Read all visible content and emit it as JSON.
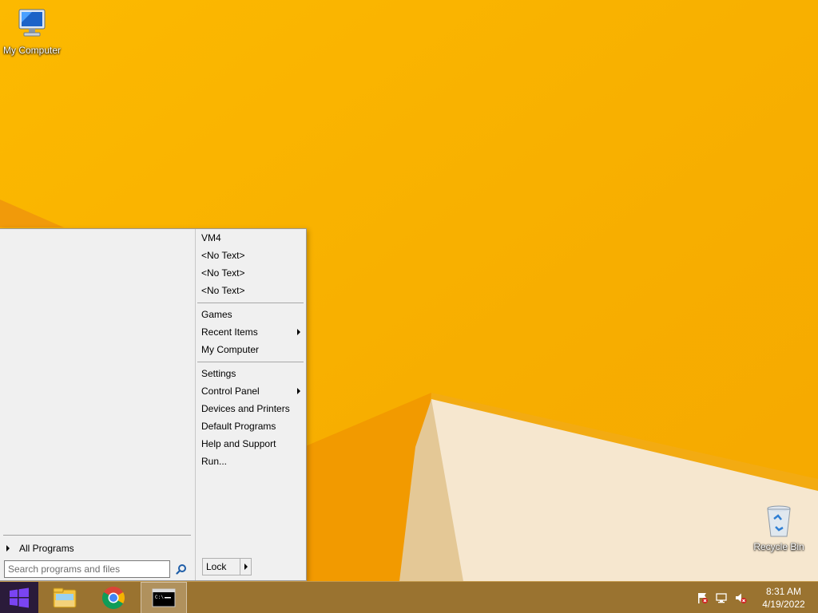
{
  "desktop": {
    "icons": [
      {
        "label": "My Computer"
      },
      {
        "label": "Recycle Bin"
      }
    ]
  },
  "start_menu": {
    "left": {
      "all_programs_label": "All Programs",
      "search_placeholder": "Search programs and files"
    },
    "right": {
      "group1": [
        "VM4",
        "<No Text>",
        "<No Text>",
        "<No Text>"
      ],
      "group2": [
        {
          "label": "Games",
          "submenu": false
        },
        {
          "label": "Recent Items",
          "submenu": true
        },
        {
          "label": "My Computer",
          "submenu": false
        }
      ],
      "group3": [
        {
          "label": "Settings",
          "submenu": false
        },
        {
          "label": "Control Panel",
          "submenu": true
        },
        {
          "label": "Devices and Printers",
          "submenu": false
        },
        {
          "label": "Default Programs",
          "submenu": false
        },
        {
          "label": "Help and Support",
          "submenu": false
        },
        {
          "label": "Run...",
          "submenu": false
        }
      ],
      "lock_label": "Lock"
    }
  },
  "taskbar": {
    "pinned": [
      "start-icon",
      "file-explorer-icon",
      "chrome-icon",
      "command-prompt-icon"
    ],
    "tray_icons": [
      "action-center-flag-icon",
      "network-icon",
      "volume-muted-icon"
    ],
    "time": "8:31 AM",
    "date": "4/19/2022"
  },
  "colors": {
    "wallpaper": "#f9b000",
    "taskbar": "#9a7330",
    "start_button": "#2a1b3a"
  }
}
